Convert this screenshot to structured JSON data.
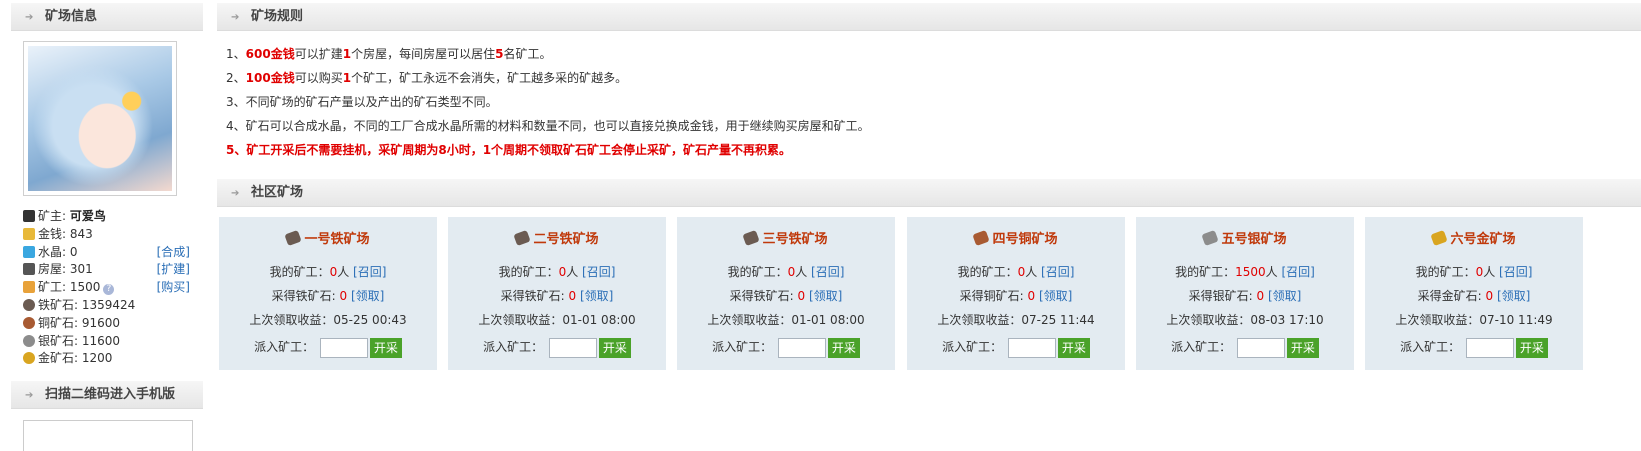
{
  "left_panel": {
    "title": "矿场信息",
    "stats": [
      {
        "label": "矿主:",
        "value": "可爱鸟",
        "action": "",
        "icon": "person-icon",
        "color": "#333333"
      },
      {
        "label": "金钱:",
        "value": "843",
        "action": "",
        "icon": "coins-icon",
        "color": "#e8b93a"
      },
      {
        "label": "水晶:",
        "value": "0",
        "action": "[合成]",
        "icon": "crystal-icon",
        "color": "#3aa7e0"
      },
      {
        "label": "房屋:",
        "value": "301",
        "action": "[扩建]",
        "icon": "house-icon",
        "color": "#555555"
      },
      {
        "label": "矿工:",
        "value": "1500",
        "action": "[购买]",
        "icon": "miner-icon",
        "color": "#e8a23a"
      },
      {
        "label": "铁矿石:",
        "value": "1359424",
        "action": "",
        "icon": "iron-ore-icon",
        "color": "#6b5b52"
      },
      {
        "label": "铜矿石:",
        "value": "91600",
        "action": "",
        "icon": "copper-ore-icon",
        "color": "#a85a32"
      },
      {
        "label": "银矿石:",
        "value": "11600",
        "action": "",
        "icon": "silver-ore-icon",
        "color": "#8c8c8c"
      },
      {
        "label": "金矿石:",
        "value": "1200",
        "action": "",
        "icon": "gold-ore-icon",
        "color": "#d9a520"
      }
    ]
  },
  "qr_panel": {
    "title": "扫描二维码进入手机版"
  },
  "rules_panel": {
    "title": "矿场规则",
    "rules": [
      {
        "parts": [
          {
            "t": "1、",
            "em": false
          },
          {
            "t": "600金钱",
            "em": true
          },
          {
            "t": "可以扩建",
            "em": false
          },
          {
            "t": "1",
            "em": true
          },
          {
            "t": "个房屋，每间房屋可以居住",
            "em": false
          },
          {
            "t": "5",
            "em": true
          },
          {
            "t": "名矿工。",
            "em": false
          }
        ]
      },
      {
        "parts": [
          {
            "t": "2、",
            "em": false
          },
          {
            "t": "100金钱",
            "em": true
          },
          {
            "t": "可以购买",
            "em": false
          },
          {
            "t": "1",
            "em": true
          },
          {
            "t": "个矿工，矿工永远不会消失，矿工越多采的矿越多。",
            "em": false
          }
        ]
      },
      {
        "parts": [
          {
            "t": "3、不同矿场的矿石产量以及产出的矿石类型不同。",
            "em": false
          }
        ]
      },
      {
        "parts": [
          {
            "t": "4、矿石可以合成水晶，不同的工厂合成水晶所需的材料和数量不同，也可以直接兑换成金钱，用于继续购买房屋和矿工。",
            "em": false
          }
        ]
      }
    ],
    "rule5": "5、矿工开采后不需要挂机，采矿周期为8小时，1个周期不领取矿石矿工会停止采矿，矿石产量不再积累。"
  },
  "mines_panel": {
    "title": "社区矿场",
    "common": {
      "my_miners_label": "我的矿工：",
      "unit": "人",
      "recall": "[召回]",
      "collect": "[领取]",
      "last_label": "上次领取收益：",
      "dispatch_label": "派入矿工：",
      "dispatch_button": "开采"
    },
    "mines": [
      {
        "name": "一号铁矿场",
        "icon": "iron-ore-icon",
        "icon_color": "#6b5b52",
        "miners": "0",
        "ore_label": "采得铁矿石:",
        "ore": "0",
        "last": "05-25 00:43"
      },
      {
        "name": "二号铁矿场",
        "icon": "iron-ore-icon",
        "icon_color": "#6b5b52",
        "miners": "0",
        "ore_label": "采得铁矿石:",
        "ore": "0",
        "last": "01-01 08:00"
      },
      {
        "name": "三号铁矿场",
        "icon": "iron-ore-icon",
        "icon_color": "#6b5b52",
        "miners": "0",
        "ore_label": "采得铁矿石:",
        "ore": "0",
        "last": "01-01 08:00"
      },
      {
        "name": "四号铜矿场",
        "icon": "copper-ore-icon",
        "icon_color": "#a85a32",
        "miners": "0",
        "ore_label": "采得铜矿石:",
        "ore": "0",
        "last": "07-25 11:44"
      },
      {
        "name": "五号银矿场",
        "icon": "silver-ore-icon",
        "icon_color": "#8c8c8c",
        "miners": "1500",
        "ore_label": "采得银矿石:",
        "ore": "0",
        "last": "08-03 17:10"
      },
      {
        "name": "六号金矿场",
        "icon": "gold-ore-icon",
        "icon_color": "#d9a520",
        "miners": "0",
        "ore_label": "采得金矿石:",
        "ore": "0",
        "last": "07-10 11:49"
      }
    ]
  }
}
